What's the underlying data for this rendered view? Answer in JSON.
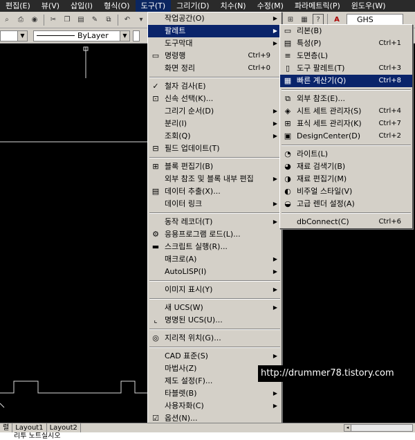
{
  "menubar": {
    "items": [
      "편집(E)",
      "뷰(V)",
      "삽입(I)",
      "형식(O)",
      "도구(T)",
      "그리기(D)",
      "치수(N)",
      "수정(M)",
      "파라메트릭(P)",
      "윈도우(W)"
    ]
  },
  "toolbar": {
    "textstyle": "GHS"
  },
  "propbar": {
    "color_value": "",
    "linetype_value": "ByLayer"
  },
  "tools_menu": {
    "items": [
      {
        "label": "작업공간(O)",
        "shortcut": "",
        "submenu": true,
        "icon": ""
      },
      {
        "label": "팔레트",
        "shortcut": "",
        "submenu": true,
        "icon": "",
        "highlight": true
      },
      {
        "label": "도구막대",
        "shortcut": "",
        "submenu": true,
        "icon": ""
      },
      {
        "label": "명령행",
        "shortcut": "Ctrl+9",
        "submenu": false,
        "icon": "cmdline-icon"
      },
      {
        "label": "화면 정리",
        "shortcut": "Ctrl+0",
        "submenu": false,
        "icon": ""
      },
      {
        "divider": true
      },
      {
        "label": "철자 검사(E)",
        "shortcut": "",
        "submenu": false,
        "icon": "spellcheck-icon"
      },
      {
        "label": "신속 선택(K)...",
        "shortcut": "",
        "submenu": false,
        "icon": "quickselect-icon"
      },
      {
        "label": "그리기 순서(D)",
        "shortcut": "",
        "submenu": true,
        "icon": ""
      },
      {
        "label": "분리(I)",
        "shortcut": "",
        "submenu": true,
        "icon": ""
      },
      {
        "label": "조회(Q)",
        "shortcut": "",
        "submenu": true,
        "icon": ""
      },
      {
        "label": "필드 업데이트(T)",
        "shortcut": "",
        "submenu": false,
        "icon": "field-icon"
      },
      {
        "divider": true
      },
      {
        "label": "블록 편집기(B)",
        "shortcut": "",
        "submenu": false,
        "icon": "block-icon"
      },
      {
        "label": "외부 참조 및 블록 내부 편집",
        "shortcut": "",
        "submenu": true,
        "icon": ""
      },
      {
        "label": "데이터 추출(X)...",
        "shortcut": "",
        "submenu": false,
        "icon": "extract-icon"
      },
      {
        "label": "데이터 링크",
        "shortcut": "",
        "submenu": true,
        "icon": ""
      },
      {
        "divider": true
      },
      {
        "label": "동작 레코더(T)",
        "shortcut": "",
        "submenu": true,
        "icon": ""
      },
      {
        "label": "응용프로그램 로드(L)...",
        "shortcut": "",
        "submenu": false,
        "icon": "appload-icon"
      },
      {
        "label": "스크립트 실행(R)...",
        "shortcut": "",
        "submenu": false,
        "icon": "script-icon"
      },
      {
        "label": "매크로(A)",
        "shortcut": "",
        "submenu": true,
        "icon": ""
      },
      {
        "label": "AutoLISP(I)",
        "shortcut": "",
        "submenu": true,
        "icon": ""
      },
      {
        "divider": true
      },
      {
        "label": "이미지 표시(Y)",
        "shortcut": "",
        "submenu": true,
        "icon": ""
      },
      {
        "divider": true
      },
      {
        "label": "새 UCS(W)",
        "shortcut": "",
        "submenu": true,
        "icon": ""
      },
      {
        "label": "명명된 UCS(U)...",
        "shortcut": "",
        "submenu": false,
        "icon": "ucs-icon"
      },
      {
        "divider": true
      },
      {
        "label": "지리적 위치(G)...",
        "shortcut": "",
        "submenu": false,
        "icon": "geo-icon"
      },
      {
        "divider": true
      },
      {
        "label": "CAD 표준(S)",
        "shortcut": "",
        "submenu": true,
        "icon": ""
      },
      {
        "label": "마법사(Z)",
        "shortcut": "",
        "submenu": true,
        "icon": ""
      },
      {
        "label": "제도 설정(F)...",
        "shortcut": "",
        "submenu": false,
        "icon": ""
      },
      {
        "label": "타블렛(B)",
        "shortcut": "",
        "submenu": true,
        "icon": ""
      },
      {
        "label": "사용자화(C)",
        "shortcut": "",
        "submenu": true,
        "icon": ""
      },
      {
        "label": "옵션(N)...",
        "shortcut": "",
        "submenu": false,
        "icon": "options-icon"
      }
    ]
  },
  "palette_menu": {
    "items": [
      {
        "label": "리본(B)",
        "shortcut": "",
        "icon": "ribbon-icon"
      },
      {
        "label": "특성(P)",
        "shortcut": "Ctrl+1",
        "icon": "properties-icon"
      },
      {
        "label": "도면층(L)",
        "shortcut": "",
        "icon": "layer-icon"
      },
      {
        "label": "도구 팔레트(T)",
        "shortcut": "Ctrl+3",
        "icon": "toolpalette-icon"
      },
      {
        "label": "빠른 계산기(Q)",
        "shortcut": "Ctrl+8",
        "icon": "calculator-icon",
        "highlight": true
      },
      {
        "divider": true
      },
      {
        "label": "외부 참조(E)...",
        "shortcut": "",
        "icon": "xref-icon"
      },
      {
        "label": "시트 세트 관리자(S)",
        "shortcut": "Ctrl+4",
        "icon": "sheetset-icon"
      },
      {
        "label": "표식 세트 관리자(K)",
        "shortcut": "Ctrl+7",
        "icon": "markup-icon"
      },
      {
        "label": "DesignCenter(D)",
        "shortcut": "Ctrl+2",
        "icon": "designcenter-icon"
      },
      {
        "divider": true
      },
      {
        "label": "라이트(L)",
        "shortcut": "",
        "icon": "light-icon"
      },
      {
        "label": "재료 검색기(B)",
        "shortcut": "",
        "icon": "material-browser-icon"
      },
      {
        "label": "재료 편집기(M)",
        "shortcut": "",
        "icon": "material-editor-icon"
      },
      {
        "label": "비주얼 스타일(V)",
        "shortcut": "",
        "icon": "visualstyle-icon"
      },
      {
        "label": "고급 렌더 설정(A)",
        "shortcut": "",
        "icon": "render-icon"
      },
      {
        "divider": true
      },
      {
        "label": "dbConnect(C)",
        "shortcut": "Ctrl+6",
        "icon": ""
      }
    ]
  },
  "tabs": [
    "Layout1",
    "Layout2"
  ],
  "tab_prefix": "렬",
  "cmdline": "리투 노트실시오",
  "watermark": "http://drummer78.tistory.com"
}
